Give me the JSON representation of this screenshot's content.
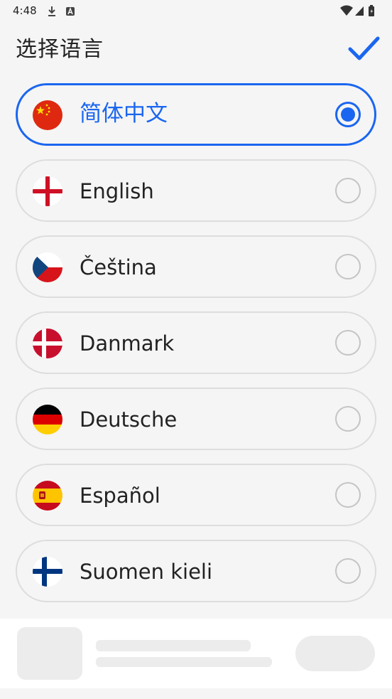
{
  "status_bar": {
    "time": "4:48"
  },
  "header": {
    "title": "选择语言"
  },
  "languages": [
    {
      "label": "简体中文",
      "flag": "china-flag",
      "selected": true
    },
    {
      "label": "English",
      "flag": "england-flag",
      "selected": false
    },
    {
      "label": "Čeština",
      "flag": "czech-flag",
      "selected": false
    },
    {
      "label": "Danmark",
      "flag": "denmark-flag",
      "selected": false
    },
    {
      "label": "Deutsche",
      "flag": "germany-flag",
      "selected": false
    },
    {
      "label": "Español",
      "flag": "spain-flag",
      "selected": false
    },
    {
      "label": "Suomen kieli",
      "flag": "finland-flag",
      "selected": false
    }
  ],
  "colors": {
    "accent": "#1a66f0",
    "background": "#f5f5f5",
    "border": "#dddddd"
  }
}
